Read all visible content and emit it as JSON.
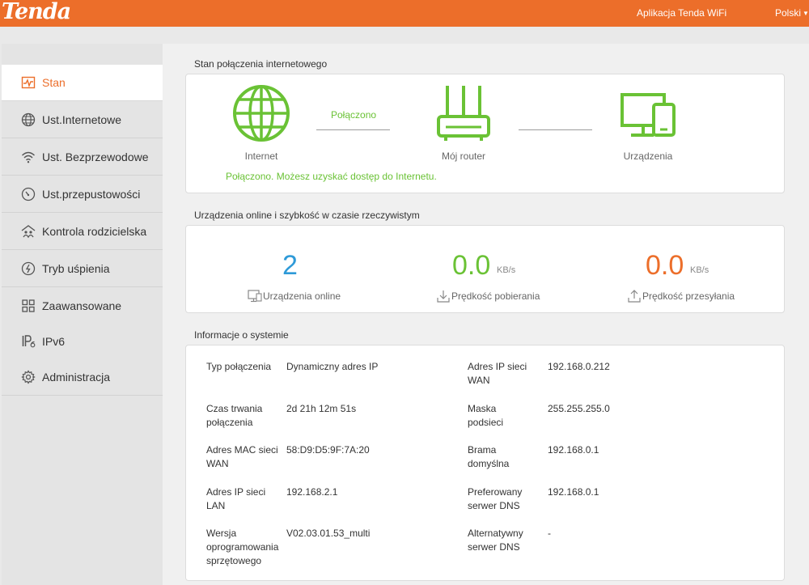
{
  "header": {
    "logo": "Tenda",
    "app_link": "Aplikacja Tenda WiFi",
    "language": "Polski"
  },
  "sidebar": {
    "items": [
      {
        "label": "Stan",
        "icon": "status-chart-icon",
        "active": true
      },
      {
        "label": "Ust.Internetowe",
        "icon": "globe-icon"
      },
      {
        "label": "Ust. Bezprzewodowe",
        "icon": "wifi-icon"
      },
      {
        "label": "Ust.przepustowości",
        "icon": "speedometer-icon"
      },
      {
        "label": "Kontrola rodzicielska",
        "icon": "family-icon"
      },
      {
        "label": "Tryb uśpienia",
        "icon": "sleep-icon"
      },
      {
        "label": "Zaawansowane",
        "icon": "grid-icon"
      },
      {
        "label": "IPv6",
        "icon": "ipv6-icon"
      },
      {
        "label": "Administracja",
        "icon": "gear-icon"
      }
    ]
  },
  "connection": {
    "title": "Stan połączenia internetowego",
    "internet_label": "Internet",
    "link_status": "Połączono",
    "router_label": "Mój router",
    "devices_label": "Urządzenia",
    "message": "Połączono. Możesz uzyskać dostęp do Internetu.",
    "accent_color": "#6ac235"
  },
  "realtime": {
    "title": "Urządzenia online i szybkość w czasie rzeczywistym",
    "online_count": "2",
    "online_label": "Urządzenia online",
    "download_value": "0.0",
    "download_unit": "KB/s",
    "download_label": "Prędkość pobierania",
    "upload_value": "0.0",
    "upload_unit": "KB/s",
    "upload_label": "Prędkość przesyłania",
    "colors": {
      "online": "#2e9ad8",
      "download": "#6ac235",
      "upload": "#ec6e2a"
    }
  },
  "system": {
    "title": "Informacje o systemie",
    "left": [
      {
        "key": "Typ połączenia",
        "value": "Dynamiczny adres IP"
      },
      {
        "key": "Czas trwania połączenia",
        "value": "2d 21h 12m 51s"
      },
      {
        "key": "Adres MAC sieci WAN",
        "value": "58:D9:D5:9F:7A:20"
      },
      {
        "key": "Adres IP sieci LAN",
        "value": "192.168.2.1"
      },
      {
        "key": "Wersja oprogramowania sprzętowego",
        "value": "V02.03.01.53_multi"
      }
    ],
    "right": [
      {
        "key": "Adres IP sieci WAN",
        "value": "192.168.0.212"
      },
      {
        "key": "Maska podsieci",
        "value": "255.255.255.0"
      },
      {
        "key": "Brama domyślna",
        "value": "192.168.0.1"
      },
      {
        "key": "Preferowany serwer DNS",
        "value": "192.168.0.1"
      },
      {
        "key": "Alternatywny serwer DNS",
        "value": "-"
      }
    ]
  }
}
